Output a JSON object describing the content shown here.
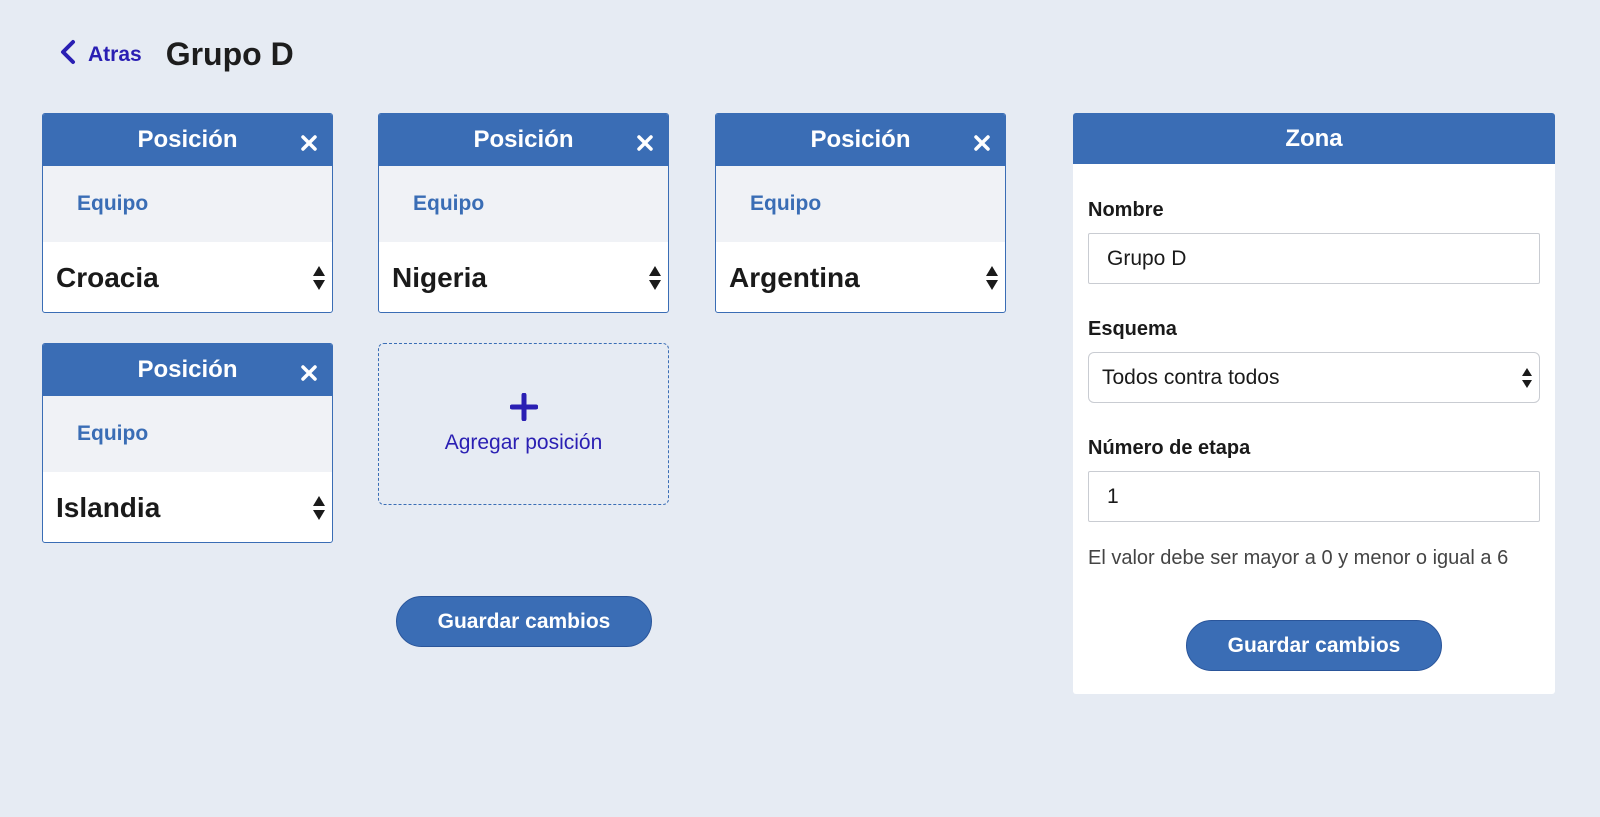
{
  "header": {
    "back_label": "Atras",
    "title": "Grupo D"
  },
  "positions": [
    {
      "header": "Posición",
      "sub_label": "Equipo",
      "team": "Croacia"
    },
    {
      "header": "Posición",
      "sub_label": "Equipo",
      "team": "Nigeria"
    },
    {
      "header": "Posición",
      "sub_label": "Equipo",
      "team": "Argentina"
    },
    {
      "header": "Posición",
      "sub_label": "Equipo",
      "team": "Islandia"
    }
  ],
  "add_position": {
    "label": "Agregar posición"
  },
  "save_label": "Guardar cambios",
  "zone_panel": {
    "title": "Zona",
    "name_label": "Nombre",
    "name_value": "Grupo D",
    "scheme_label": "Esquema",
    "scheme_value": "Todos contra todos",
    "stage_label": "Número de etapa",
    "stage_value": "1",
    "hint": "El valor debe ser mayor a 0 y menor o igual a 6",
    "save_label": "Guardar cambios"
  },
  "colors": {
    "background": "#e6ebf3",
    "primary": "#3a6db5",
    "link": "#2a1fb3"
  }
}
